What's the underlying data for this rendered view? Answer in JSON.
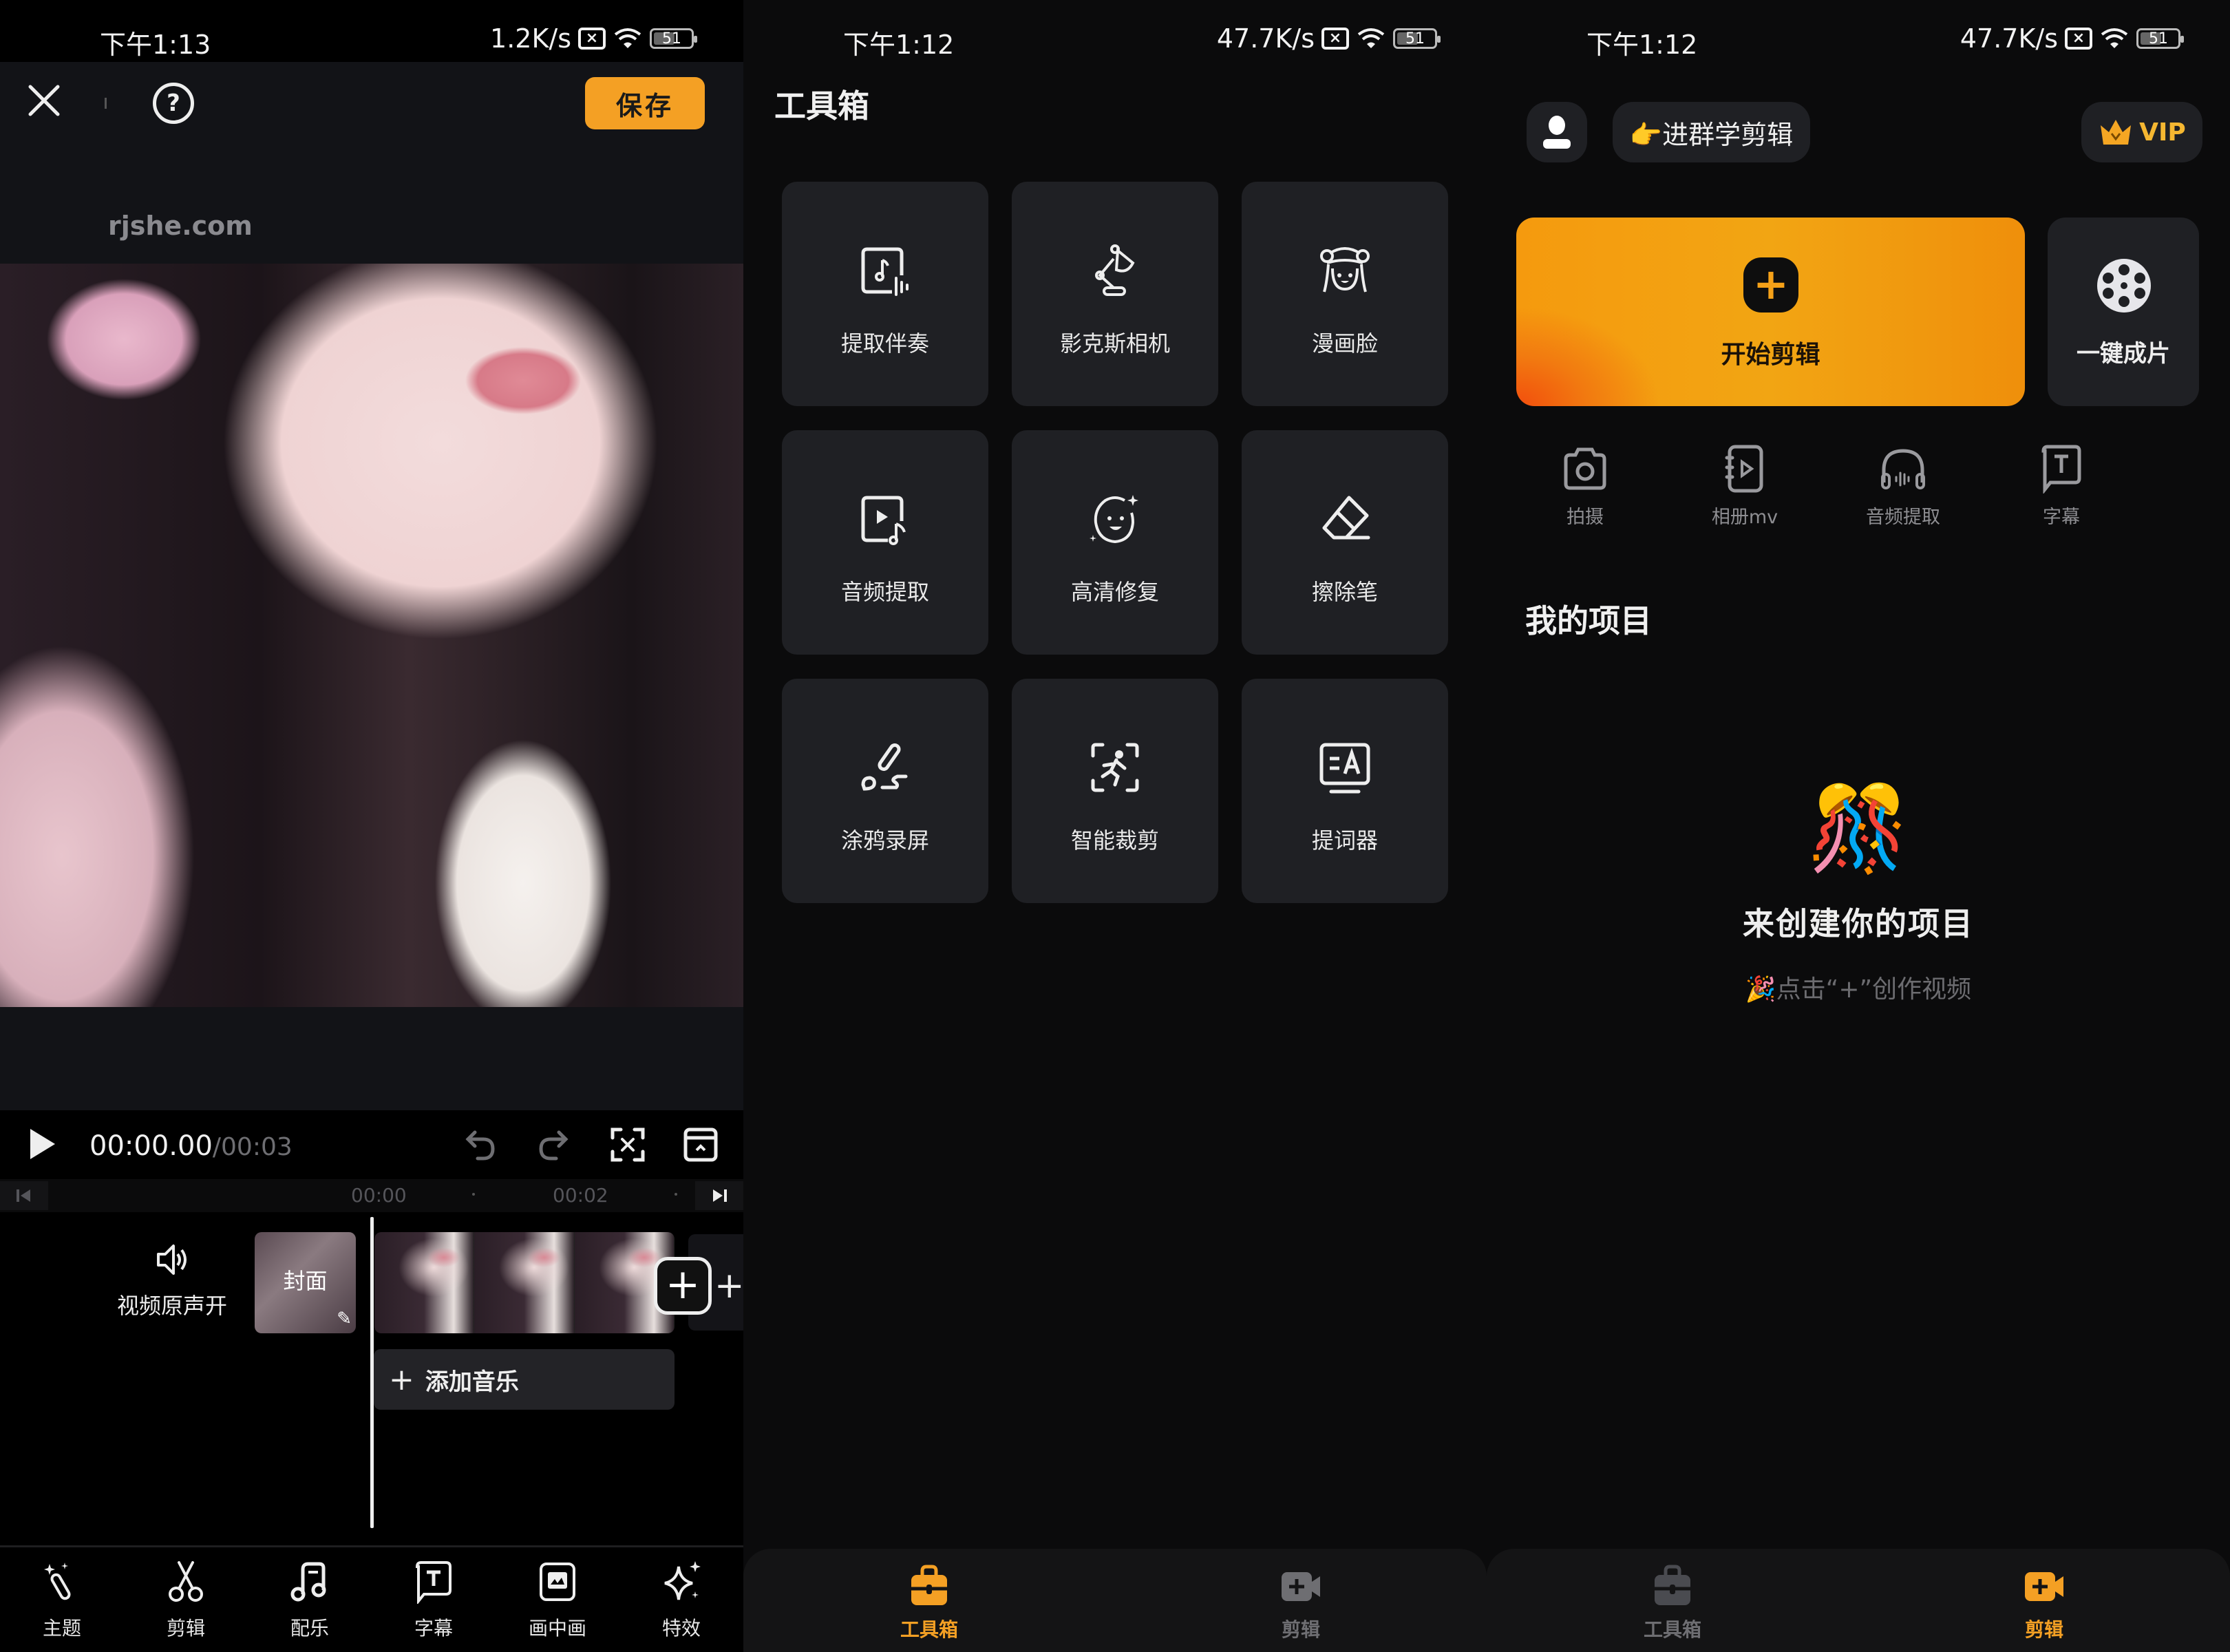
{
  "editor": {
    "status": {
      "time": "下午1:13",
      "speed": "1.2K/s",
      "battery": "51"
    },
    "save_label": "保存",
    "watermark": "rjshe.com",
    "timecode_current": "00:00.00",
    "timecode_total": "/00:03",
    "ruler_labels": [
      "00:00",
      "00:02"
    ],
    "audio_toggle_label": "视频原声开",
    "cover_label": "封面",
    "add_music_label": "添加音乐",
    "tools": [
      {
        "label": "主题",
        "icon": "magic-wand-icon"
      },
      {
        "label": "剪辑",
        "icon": "scissors-icon"
      },
      {
        "label": "配乐",
        "icon": "music-note-icon"
      },
      {
        "label": "字幕",
        "icon": "caption-icon"
      },
      {
        "label": "画中画",
        "icon": "picture-in-picture-icon"
      },
      {
        "label": "特效",
        "icon": "sparkle-icon"
      }
    ]
  },
  "toolbox": {
    "status": {
      "time": "下午1:12",
      "speed": "47.7K/s",
      "battery": "51"
    },
    "title": "工具箱",
    "cards": [
      {
        "label": "提取伴奏",
        "icon": "extract-accompaniment-icon"
      },
      {
        "label": "影克斯相机",
        "icon": "desk-lamp-icon"
      },
      {
        "label": "漫画脸",
        "icon": "cartoon-face-icon"
      },
      {
        "label": "音频提取",
        "icon": "audio-extract-icon"
      },
      {
        "label": "高清修复",
        "icon": "hd-restore-icon"
      },
      {
        "label": "擦除笔",
        "icon": "eraser-icon"
      },
      {
        "label": "涂鸦录屏",
        "icon": "doodle-record-icon"
      },
      {
        "label": "智能裁剪",
        "icon": "smart-crop-icon"
      },
      {
        "label": "提词器",
        "icon": "teleprompter-icon"
      }
    ],
    "nav": [
      {
        "label": "工具箱",
        "active": true
      },
      {
        "label": "剪辑",
        "active": false
      }
    ]
  },
  "home": {
    "status": {
      "time": "下午1:12",
      "speed": "47.7K/s",
      "battery": "51"
    },
    "group_label": "👉进群学剪辑",
    "vip_label": "VIP",
    "start_edit_label": "开始剪辑",
    "one_click_label": "一键成片",
    "quick_actions": [
      {
        "label": "拍摄",
        "icon": "camera-icon"
      },
      {
        "label": "相册mv",
        "icon": "album-mv-icon"
      },
      {
        "label": "音频提取",
        "icon": "headphones-icon"
      },
      {
        "label": "字幕",
        "icon": "caption-icon"
      }
    ],
    "projects_title": "我的项目",
    "empty_emoji": "🎊",
    "empty_title": "来创建你的项目",
    "empty_subtitle": "🎉点击“+”创作视频",
    "nav": [
      {
        "label": "工具箱",
        "active": false
      },
      {
        "label": "剪辑",
        "active": true
      }
    ]
  },
  "colors": {
    "accent": "#f4a024",
    "card_bg": "#1f2024",
    "inactive": "#6e6e72"
  }
}
